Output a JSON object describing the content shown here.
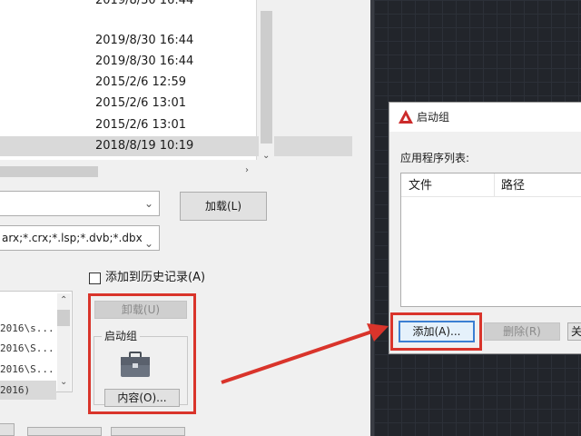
{
  "file_list": {
    "dates": [
      "2019/8/30 16:44",
      "2019/8/30 16:44",
      "2019/8/30 16:44",
      "2015/2/6 12:59",
      "2015/2/6 13:01",
      "2015/2/6 13:01",
      "2018/8/19 10:19"
    ],
    "selected_index": 6
  },
  "load_button": "加载(L)",
  "file_type_filter": "arx;*.crx;*.lsp;*.dvb;*.dbx",
  "add_to_history": {
    "label": "添加到历史记录(A)",
    "checked": false
  },
  "history_list": [
    "2016\\s...",
    "2016\\S...",
    "2016\\S...",
    "2016)"
  ],
  "unload_button": "卸载(U)",
  "startup_group": {
    "label": "启动组",
    "icon": "briefcase-icon",
    "contents_button": "内容(O)..."
  },
  "startup_dialog": {
    "title": "启动组",
    "list_label": "应用程序列表:",
    "columns": [
      "文件",
      "路径"
    ],
    "add_button": "添加(A)...",
    "delete_button": "删除(R)",
    "close_button_partial": "关"
  },
  "colors": {
    "highlight": "#d9342b",
    "canvas": "#22252b",
    "autocad_red": "#cc2b2b"
  }
}
